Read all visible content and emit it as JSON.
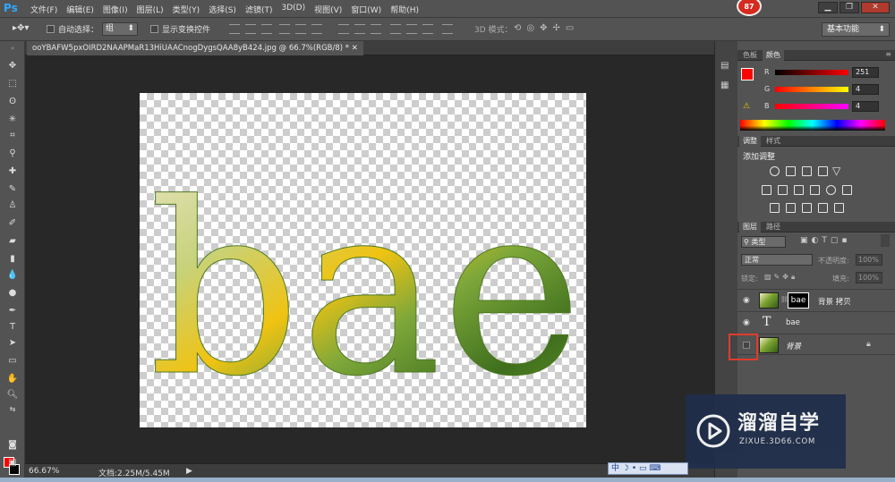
{
  "app": {
    "logo": "Ps"
  },
  "menu": [
    "文件(F)",
    "编辑(E)",
    "图像(I)",
    "图层(L)",
    "类型(Y)",
    "选择(S)",
    "滤镜(T)",
    "3D(D)",
    "视图(V)",
    "窗口(W)",
    "帮助(H)"
  ],
  "notification_badge": "87",
  "window_controls": {
    "minimize": "▁",
    "restore": "❐",
    "close": "✕"
  },
  "options": {
    "auto_select_label": "自动选择：",
    "auto_select_value": "组",
    "show_transform_label": "显示变换控件",
    "mode_3d_label": "3D 模式：",
    "workspace": "基本功能"
  },
  "document": {
    "tab_title": "ooYBAFW5pxOIRD2NAAPMaR13HiUAACnogDygsQAA8yB424.jpg @ 66.7%(RGB/8) *",
    "canvas_text": "bae"
  },
  "status": {
    "zoom": "66.67%",
    "doc_size": "文档:2.25M/5.45M"
  },
  "color_panel": {
    "tabs": [
      "色板",
      "颜色"
    ],
    "channels": [
      {
        "label": "R",
        "value": "251"
      },
      {
        "label": "G",
        "value": "4"
      },
      {
        "label": "B",
        "value": "4"
      }
    ],
    "foreground": "#fb0404",
    "background": "#000000"
  },
  "adjust_panel": {
    "tabs": [
      "调整",
      "样式"
    ],
    "title": "添加调整"
  },
  "layers_panel": {
    "tabs": [
      "图层",
      "路径"
    ],
    "filter_kind": "类型",
    "blend_mode": "正常",
    "opacity_label": "不透明度:",
    "opacity_value": "100%",
    "lock_label": "锁定:",
    "fill_label": "填充:",
    "fill_value": "100%",
    "layers": [
      {
        "name": "背景 拷贝",
        "mask_text": "bae"
      },
      {
        "name": "bae",
        "type_glyph": "T"
      },
      {
        "name": "背景"
      }
    ]
  },
  "watermark": {
    "cn": "溜溜自学",
    "en": "ZIXUE.3D66.COM"
  },
  "ime": {
    "text": "中"
  }
}
